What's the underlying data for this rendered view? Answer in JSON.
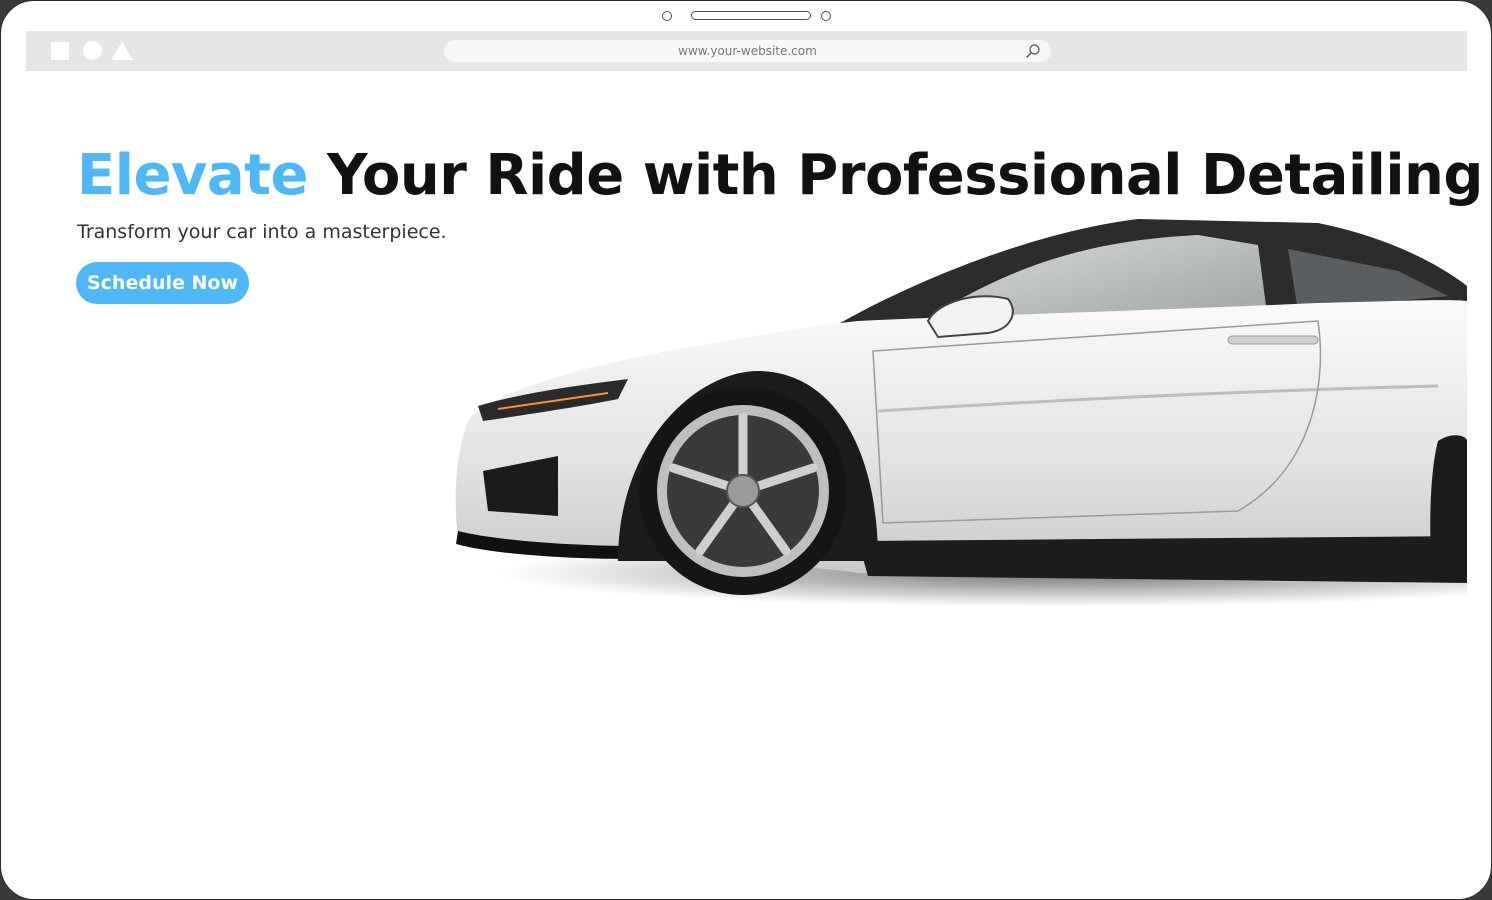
{
  "browser": {
    "url": "www.your-website.com",
    "window_controls": [
      "square-icon",
      "circle-icon",
      "triangle-icon"
    ],
    "search_icon": "search-icon"
  },
  "hero": {
    "headline_accent": "Elevate",
    "headline_rest": " Your Ride with Professional Detailing",
    "subheadline": "Transform your car into a masterpiece.",
    "cta_label": "Schedule Now",
    "image": "white sports car"
  },
  "colors": {
    "accent": "#4db8f5",
    "headline": "#111111",
    "browser_bar": "#e6e6e6"
  }
}
